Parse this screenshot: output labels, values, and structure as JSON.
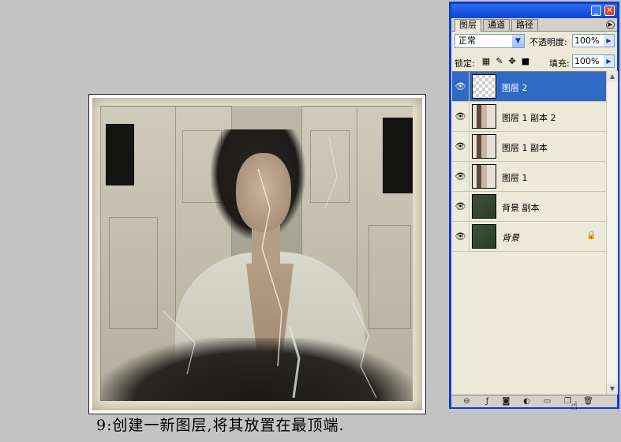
{
  "caption": "9:创建一新图层,将其放置在最顶端.",
  "palette": {
    "tabs": [
      "图层",
      "通道",
      "路径"
    ],
    "active_tab": "图层",
    "blend_mode": "正常",
    "opacity_label": "不透明度:",
    "opacity_value": "100%",
    "lock_label": "锁定:",
    "fill_label": "填充:",
    "fill_value": "100%",
    "layers": [
      {
        "name": "图层 2",
        "thumbnail": "transparent",
        "selected": true,
        "visible": true
      },
      {
        "name": "图层 1 副本 2",
        "thumbnail": "portrait",
        "selected": false,
        "visible": true
      },
      {
        "name": "图层 1 副本",
        "thumbnail": "portrait",
        "selected": false,
        "visible": true
      },
      {
        "name": "图层 1",
        "thumbnail": "portrait",
        "selected": false,
        "visible": true
      },
      {
        "name": "背景 副本",
        "thumbnail": "green",
        "selected": false,
        "visible": true
      },
      {
        "name": "背景",
        "thumbnail": "green",
        "selected": false,
        "visible": true,
        "locked": true
      }
    ],
    "bottom_icons": [
      "link-icon",
      "layer-style-icon",
      "mask-icon",
      "adjustment-layer-icon",
      "folder-icon",
      "new-layer-icon",
      "trash-icon"
    ]
  },
  "colors": {
    "window_border": "#0a3fd0",
    "selection": "#316ac5",
    "desktop": "#c3c3c3"
  }
}
